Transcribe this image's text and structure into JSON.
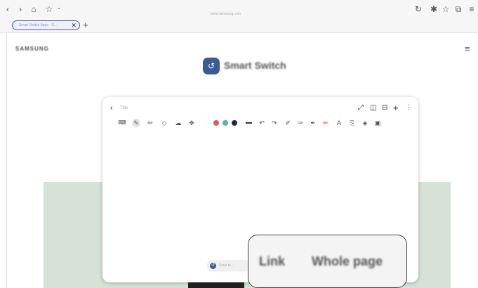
{
  "browser": {
    "url": "www.samsung.com",
    "tab_title": "Smart Switch Apps - S...",
    "tab_close": "✕",
    "new_tab": "+",
    "nav": {
      "back": "‹",
      "forward": "›",
      "home": "⌂",
      "bookmark": "☆",
      "lock": "▪"
    },
    "right": {
      "reload": "↻",
      "pin": "✱",
      "star": "☆",
      "tabs": "⧉",
      "menu": "≡"
    }
  },
  "page": {
    "brand": "SAMSUNG",
    "menu_icon": "≡",
    "app_title": "Smart Switch",
    "app_logo": "↺"
  },
  "note": {
    "back": "‹",
    "title": "Title",
    "actions": {
      "expand": "⤢",
      "book": "◫",
      "pages": "⊟",
      "add": "+",
      "more": "⋮"
    },
    "pen_colors": [
      "#e05a5a",
      "#5ab5a0",
      "#1f2a44"
    ],
    "bottom_pill": "Save to..."
  },
  "callout": {
    "link": "Link",
    "whole_page": "Whole page"
  }
}
